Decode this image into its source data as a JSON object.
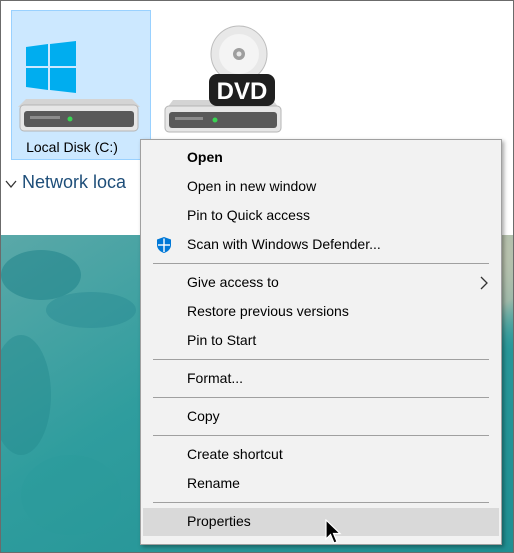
{
  "explorer": {
    "drives": [
      {
        "label": "Local Disk (C:)",
        "icon": "windows-drive-icon",
        "selected": true
      },
      {
        "label": "",
        "icon": "dvd-drive-icon",
        "badge": "DVD"
      }
    ],
    "network_section": {
      "label": "Network loca",
      "icon": "chevron-down-icon"
    }
  },
  "context_menu": {
    "items": [
      {
        "label": "Open",
        "bold": true
      },
      {
        "label": "Open in new window"
      },
      {
        "label": "Pin to Quick access"
      },
      {
        "label": "Scan with Windows Defender...",
        "icon": "windows-defender-shield-icon"
      },
      {
        "label": "Give access to",
        "submenu": true
      },
      {
        "label": "Restore previous versions"
      },
      {
        "label": "Pin to Start"
      },
      {
        "label": "Format..."
      },
      {
        "label": "Copy"
      },
      {
        "label": "Create shortcut"
      },
      {
        "label": "Rename"
      },
      {
        "label": "Properties",
        "hovered": true
      }
    ]
  },
  "colors": {
    "selection_bg": "#cce8ff",
    "selection_border": "#99d1ff",
    "menu_bg": "#f2f2f2",
    "menu_hover": "#d9d9d9",
    "defender_blue": "#0078d7",
    "windows_logo": "#00adef",
    "network_text": "#1e4e79"
  }
}
